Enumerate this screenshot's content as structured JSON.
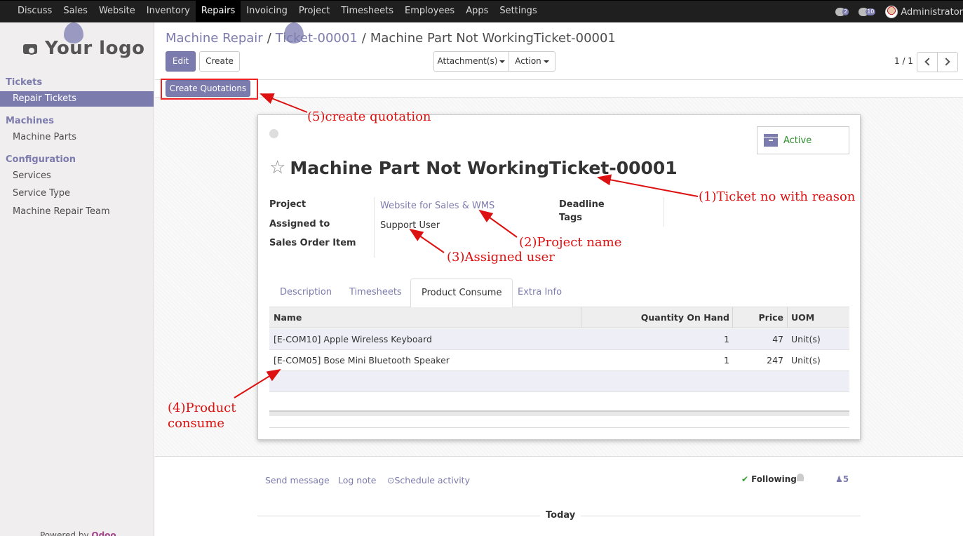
{
  "topbar": {
    "menu": [
      "Discuss",
      "Sales",
      "Website",
      "Inventory",
      "Repairs",
      "Invoicing",
      "Project",
      "Timesheets",
      "Employees",
      "Apps",
      "Settings"
    ],
    "active": "Repairs",
    "activity_count": "2",
    "message_count": "10",
    "user": "Administrator"
  },
  "sidebar": {
    "logo": "Your logo",
    "sections": [
      {
        "title": "Tickets",
        "items": [
          "Repair Tickets"
        ]
      },
      {
        "title": "Machines",
        "items": [
          "Machine Parts"
        ]
      },
      {
        "title": "Configuration",
        "items": [
          "Services",
          "Service Type",
          "Machine Repair Team"
        ]
      }
    ],
    "active_item": "Repair Tickets",
    "powered_by": "Powered by",
    "powered_brand": "Odoo"
  },
  "breadcrumb": {
    "level1": "Machine Repair",
    "sep": "/",
    "level2": "Ticket-00001",
    "current": "Machine Part Not WorkingTicket-00001"
  },
  "toolbar": {
    "edit": "Edit",
    "create": "Create",
    "attachments": "Attachment(s)",
    "action": "Action",
    "pager": "1 / 1",
    "create_quotations": "Create Quotations"
  },
  "record": {
    "status": "Active",
    "title": "Machine Part Not WorkingTicket-00001",
    "fields": {
      "project_label": "Project",
      "project_value": "Website for Sales & WMS",
      "assigned_label": "Assigned to",
      "assigned_value": "Support User",
      "sales_order_label": "Sales Order Item",
      "deadline_label": "Deadline",
      "tags_label": "Tags"
    },
    "tabs": [
      "Description",
      "Timesheets",
      "Product Consume",
      "Extra Info"
    ],
    "active_tab": "Product Consume",
    "table": {
      "headers": {
        "name": "Name",
        "qty": "Quantity On Hand",
        "price": "Price",
        "uom": "UOM"
      },
      "rows": [
        {
          "name": "[E-COM10] Apple Wireless Keyboard",
          "qty": "1",
          "price": "47",
          "uom": "Unit(s)"
        },
        {
          "name": "[E-COM05] Bose Mini Bluetooth Speaker",
          "qty": "1",
          "price": "247",
          "uom": "Unit(s)"
        }
      ]
    }
  },
  "chatter": {
    "send_message": "Send message",
    "log_note": "Log note",
    "schedule_activity": "Schedule activity",
    "following": "Following",
    "followers_count": "5",
    "today": "Today"
  },
  "annotations": {
    "a1": "(1)Ticket no with reason",
    "a2": "(2)Project name",
    "a3": "(3)Assigned user",
    "a4_line1": "(4)Product",
    "a4_line2": "consume",
    "a5": "(5)create quotation"
  },
  "colors": {
    "brand": "#7c7bad",
    "annotation": "#dd1111",
    "active_status": "#2f8f2f"
  }
}
